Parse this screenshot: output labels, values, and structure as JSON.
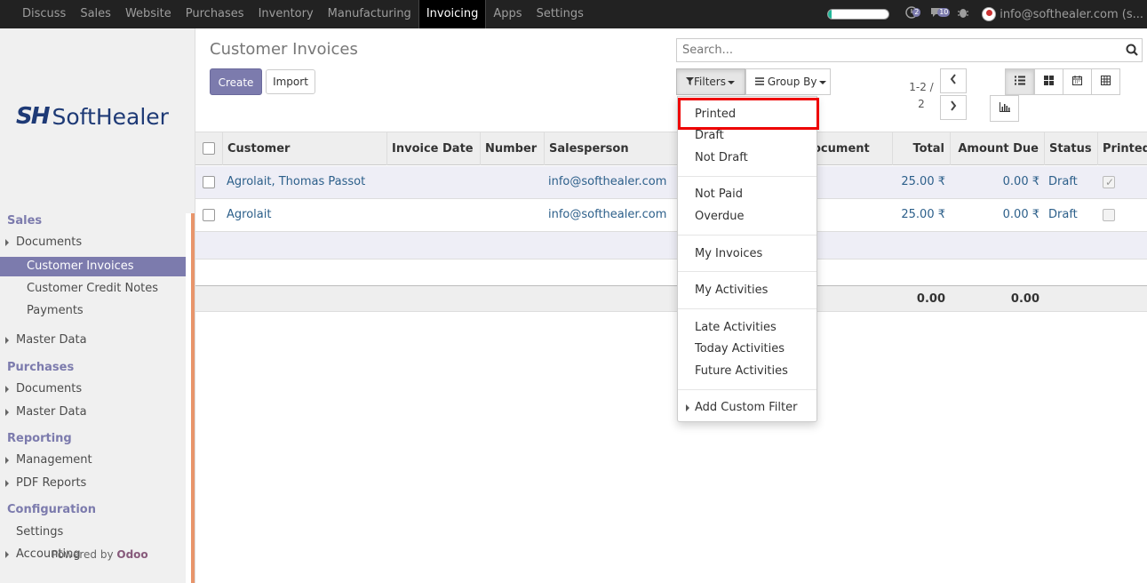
{
  "navbar": {
    "apps": [
      "Discuss",
      "Sales",
      "Website",
      "Purchases",
      "Inventory",
      "Manufacturing",
      "Invoicing",
      "Apps",
      "Settings"
    ],
    "active_app": "Invoicing",
    "activity_badge": "2",
    "messages_badge": "10",
    "user_label": "info@softhealer.com (s..."
  },
  "sidebar": {
    "logo_mark": "SH",
    "logo_text": "SoftHealer",
    "sections": {
      "sales": "Sales",
      "purchases": "Purchases",
      "reporting": "Reporting",
      "configuration": "Configuration"
    },
    "items": {
      "sales_documents": "Documents",
      "customer_invoices": "Customer Invoices",
      "customer_credit_notes": "Customer Credit Notes",
      "payments": "Payments",
      "sales_master_data": "Master Data",
      "purchases_documents": "Documents",
      "purchases_master_data": "Master Data",
      "management": "Management",
      "pdf_reports": "PDF Reports",
      "settings": "Settings",
      "accounting": "Accounting"
    },
    "powered_by": "Powered by",
    "powered_brand": "Odoo"
  },
  "control_panel": {
    "title": "Customer Invoices",
    "create_label": "Create",
    "import_label": "Import",
    "search_placeholder": "Search...",
    "filters_label": "Filters",
    "groupby_label": "Group By",
    "pager_text": "1-2 / 2"
  },
  "table": {
    "columns": {
      "customer": "Customer",
      "invoice_date": "Invoice Date",
      "number": "Number",
      "salesperson": "Salesperson",
      "source_document": "ocument",
      "total": "Total",
      "amount_due": "Amount Due",
      "status": "Status",
      "printed": "Printed"
    },
    "rows": [
      {
        "customer": "Agrolait, Thomas Passot",
        "salesperson": "info@softhealer.com",
        "total": "25.00 ₹",
        "amount_due": "0.00 ₹",
        "status": "Draft",
        "printed": true
      },
      {
        "customer": "Agrolait",
        "salesperson": "info@softhealer.com",
        "total": "25.00 ₹",
        "amount_due": "0.00 ₹",
        "status": "Draft",
        "printed": false
      }
    ],
    "footer": {
      "total": "0.00",
      "amount_due": "0.00"
    }
  },
  "filters_dropdown": {
    "printed": "Printed",
    "draft": "Draft",
    "not_draft": "Not Draft",
    "not_paid": "Not Paid",
    "overdue": "Overdue",
    "my_invoices": "My Invoices",
    "my_activities": "My Activities",
    "late_activities": "Late Activities",
    "today_activities": "Today Activities",
    "future_activities": "Future Activities",
    "add_custom_filter": "Add Custom Filter"
  },
  "colors": {
    "brand": "#7c7bad",
    "navbar": "#222222",
    "highlight": "#ee0000",
    "link": "#2c5f8a"
  }
}
